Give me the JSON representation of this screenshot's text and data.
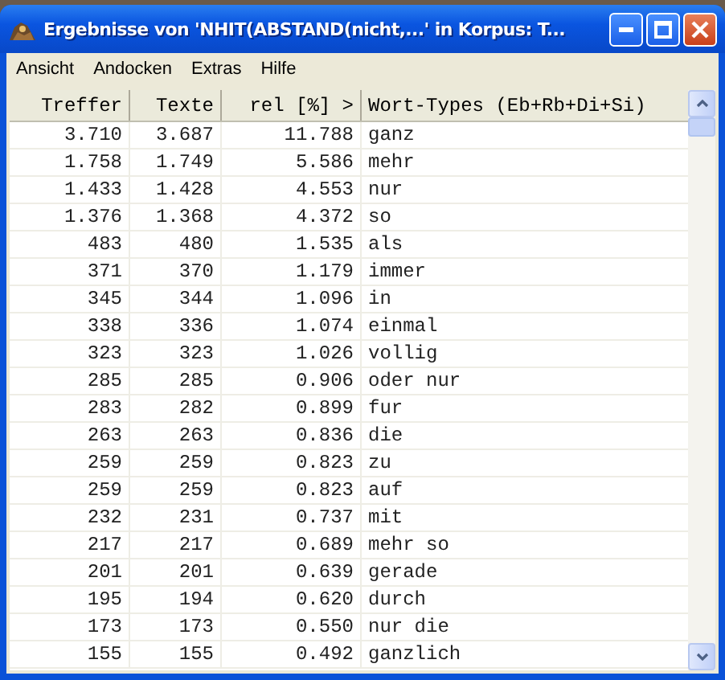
{
  "window": {
    "title": "Ergebnisse von 'NHIT(ABSTAND(nicht,...' in Korpus: T..."
  },
  "menu": [
    "Ansicht",
    "Andocken",
    "Extras",
    "Hilfe"
  ],
  "table": {
    "columns": [
      "Treffer",
      "Texte",
      "rel [%] >",
      "Wort-Types (Eb+Rb+Di+Si)"
    ],
    "rows": [
      [
        "3.710",
        "3.687",
        "11.788",
        "ganz"
      ],
      [
        "1.758",
        "1.749",
        "5.586",
        "mehr"
      ],
      [
        "1.433",
        "1.428",
        "4.553",
        "nur"
      ],
      [
        "1.376",
        "1.368",
        "4.372",
        "so"
      ],
      [
        "483",
        "480",
        "1.535",
        "als"
      ],
      [
        "371",
        "370",
        "1.179",
        "immer"
      ],
      [
        "345",
        "344",
        "1.096",
        "in"
      ],
      [
        "338",
        "336",
        "1.074",
        "einmal"
      ],
      [
        "323",
        "323",
        "1.026",
        "vollig"
      ],
      [
        "285",
        "285",
        "0.906",
        "oder nur"
      ],
      [
        "283",
        "282",
        "0.899",
        "fur"
      ],
      [
        "263",
        "263",
        "0.836",
        "die"
      ],
      [
        "259",
        "259",
        "0.823",
        "zu"
      ],
      [
        "259",
        "259",
        "0.823",
        "auf"
      ],
      [
        "232",
        "231",
        "0.737",
        "mit"
      ],
      [
        "217",
        "217",
        "0.689",
        "mehr so"
      ],
      [
        "201",
        "201",
        "0.639",
        "gerade"
      ],
      [
        "195",
        "194",
        "0.620",
        "durch"
      ],
      [
        "173",
        "173",
        "0.550",
        "nur die"
      ],
      [
        "155",
        "155",
        "0.492",
        "ganzlich"
      ]
    ]
  }
}
